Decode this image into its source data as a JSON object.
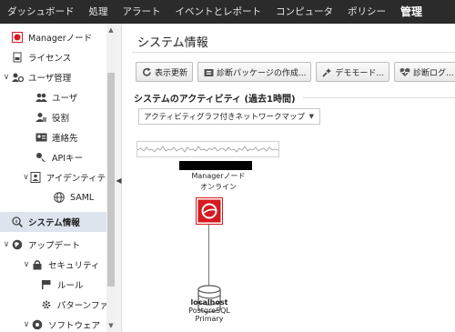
{
  "topnav": {
    "items": [
      "ダッシュボード",
      "処理",
      "アラート",
      "イベントとレポート",
      "コンピュータ",
      "ポリシー",
      "管理"
    ],
    "active_index": 6
  },
  "sidebar": {
    "items": [
      {
        "label": "Managerノード",
        "icon": "manager-node-icon",
        "chevron": ""
      },
      {
        "label": "ライセンス",
        "icon": "license-icon",
        "chevron": ""
      },
      {
        "label": "ユーザ管理",
        "icon": "users-gear-icon",
        "chevron": "∨"
      },
      {
        "label": "ユーザ",
        "icon": "users-icon",
        "chevron": ""
      },
      {
        "label": "役割",
        "icon": "role-icon",
        "chevron": ""
      },
      {
        "label": "連絡先",
        "icon": "contact-card-icon",
        "chevron": ""
      },
      {
        "label": "APIキー",
        "icon": "key-icon",
        "chevron": ""
      },
      {
        "label": "アイデンティティ",
        "icon": "identity-icon",
        "chevron": "∨"
      },
      {
        "label": "SAML",
        "icon": "saml-globe-icon",
        "chevron": ""
      },
      {
        "label": "システム情報",
        "icon": "system-info-icon",
        "chevron": ""
      },
      {
        "label": "アップデート",
        "icon": "update-globe-icon",
        "chevron": "∨"
      },
      {
        "label": "セキュリティ",
        "icon": "lock-icon",
        "chevron": "∨"
      },
      {
        "label": "ルール",
        "icon": "rule-flag-icon",
        "chevron": ""
      },
      {
        "label": "パターンファ",
        "icon": "pattern-gear-icon",
        "chevron": ""
      },
      {
        "label": "ソフトウェア",
        "icon": "software-icon",
        "chevron": "∨"
      }
    ],
    "selected_index": 9
  },
  "main": {
    "title": "システム情報",
    "toolbar": {
      "refresh": "表示更新",
      "diagnostic_package": "診断パッケージの作成...",
      "demo_mode": "デモモード...",
      "diagnostic_log": "診断ログ..."
    },
    "activity": {
      "section_title": "システムのアクティビティ (過去1時間)",
      "select_value": "アクティビティグラフ付きネットワークマップ"
    },
    "node": {
      "name": "Managerノード",
      "status": "オンライン"
    },
    "database": {
      "host": "localhost",
      "engine": "PostgreSQL",
      "role": "Primary"
    }
  },
  "colors": {
    "topnav_bg": "#2b2b2b",
    "trend_red": "#d71920",
    "selected_bg": "#dde4ee"
  }
}
